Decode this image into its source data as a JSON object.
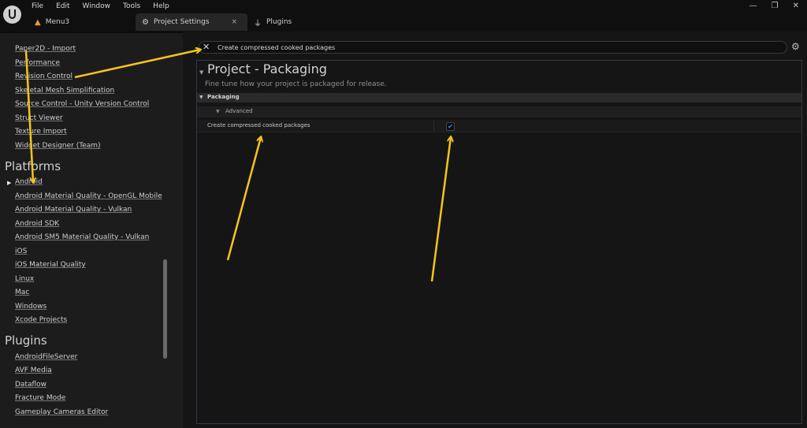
{
  "menu": [
    "File",
    "Edit",
    "Window",
    "Tools",
    "Help"
  ],
  "window_controls": {
    "minimize": "—",
    "restore": "❐",
    "close": "✕"
  },
  "tabs": [
    {
      "label": "Menu3",
      "icon": "level-icon"
    },
    {
      "label": "Project Settings",
      "icon": "settings-icon",
      "close": "×"
    },
    {
      "label": "Plugins",
      "icon": "plug-icon"
    }
  ],
  "sidebar": {
    "top_items": [
      "Paper2D - Import",
      "Performance",
      "Revision Control",
      "Skeletal Mesh Simplification",
      "Source Control - Unity Version Control",
      "Struct Viewer",
      "Texture Import",
      "Widget Designer (Team)"
    ],
    "platforms_heading": "Platforms",
    "platform_items": [
      "Android",
      "Android Material Quality - OpenGL Mobile",
      "Android Material Quality - Vulkan",
      "Android SDK",
      "Android SM5 Material Quality - Vulkan",
      "iOS",
      "iOS Material Quality",
      "Linux",
      "Mac",
      "Windows",
      "Xcode Projects"
    ],
    "plugins_heading": "Plugins",
    "plugin_items": [
      "AndroidFileServer",
      "AVF Media",
      "Dataflow",
      "Fracture Mode",
      "Gameplay Cameras Editor"
    ]
  },
  "search": {
    "value": "Create compressed cooked packages",
    "clear": "✕"
  },
  "section": {
    "title": "Project - Packaging",
    "description": "Fine tune how your project is packaged for release.",
    "category": "Packaging",
    "advanced": "Advanced",
    "property": {
      "label": "Create compressed cooked packages",
      "checked": true,
      "check_glyph": "✔"
    }
  },
  "annotation_color": "#f5c518"
}
